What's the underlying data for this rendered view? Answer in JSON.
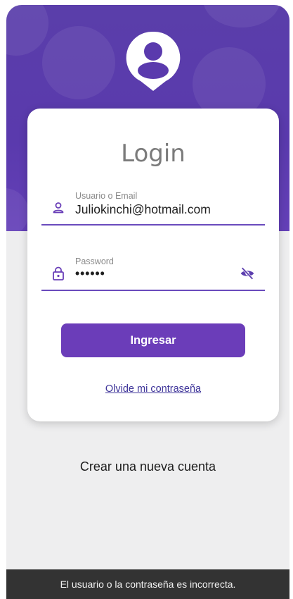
{
  "login": {
    "title": "Login",
    "username_label": "Usuario o Email",
    "username_value": "Juliokinchi@hotmail.com",
    "password_label": "Password",
    "password_value": "••••••",
    "submit_label": "Ingresar",
    "forgot_label": "Olvide mi contraseña"
  },
  "create_account_label": "Crear una nueva cuenta",
  "snackbar": {
    "message": "El usuario o la contraseña es incorrecta."
  },
  "colors": {
    "header": "#5a3aad",
    "accent": "#6b3db9",
    "link": "#3d3399",
    "snackbar": "#333333"
  },
  "icons": [
    "user-avatar-icon",
    "person-icon",
    "lock-icon",
    "visibility-off-icon"
  ]
}
